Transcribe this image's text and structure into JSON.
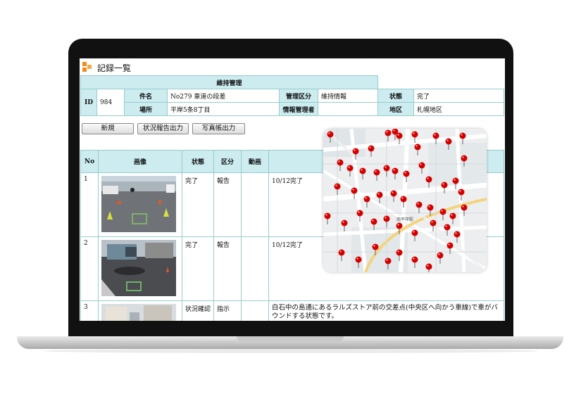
{
  "app": {
    "title": "記録一覧"
  },
  "info": {
    "section_header": "維持管理",
    "id_label": "ID",
    "id_value": "984",
    "subject_label": "件名",
    "subject_value": "No279 車道の段差",
    "category_label": "管理区分",
    "category_value": "維持情報",
    "status_label": "状態",
    "status_value": "完了",
    "place_label": "場所",
    "place_value": "平岸5条8丁目",
    "manager_label": "情報管理者",
    "manager_value": "",
    "district_label": "地区",
    "district_value": "札幌地区"
  },
  "buttons": {
    "new": "新規",
    "status_report": "状況報告出力",
    "photo_book": "写真帳出力"
  },
  "records": {
    "columns": [
      "No",
      "画像",
      "状態",
      "区分",
      "動画",
      ""
    ],
    "rows": [
      {
        "no": "1",
        "status": "完了",
        "type": "報告",
        "video": "",
        "note": "10/12完了"
      },
      {
        "no": "2",
        "status": "完了",
        "type": "報告",
        "video": "",
        "note": "10/12完了"
      },
      {
        "no": "3",
        "status": "状況確認",
        "type": "指示",
        "video": "",
        "note": "白石中の島通にあるラルズストア前の交差点(中央区へ向かう車線)で車がバウンドする状態です。"
      }
    ]
  },
  "map": {
    "label": "南平岸駅",
    "pin_color": "#d40000"
  },
  "colors": {
    "header_bg": "#ccecf0",
    "border": "#99cccc",
    "logo_orange": "#f08c1e"
  }
}
